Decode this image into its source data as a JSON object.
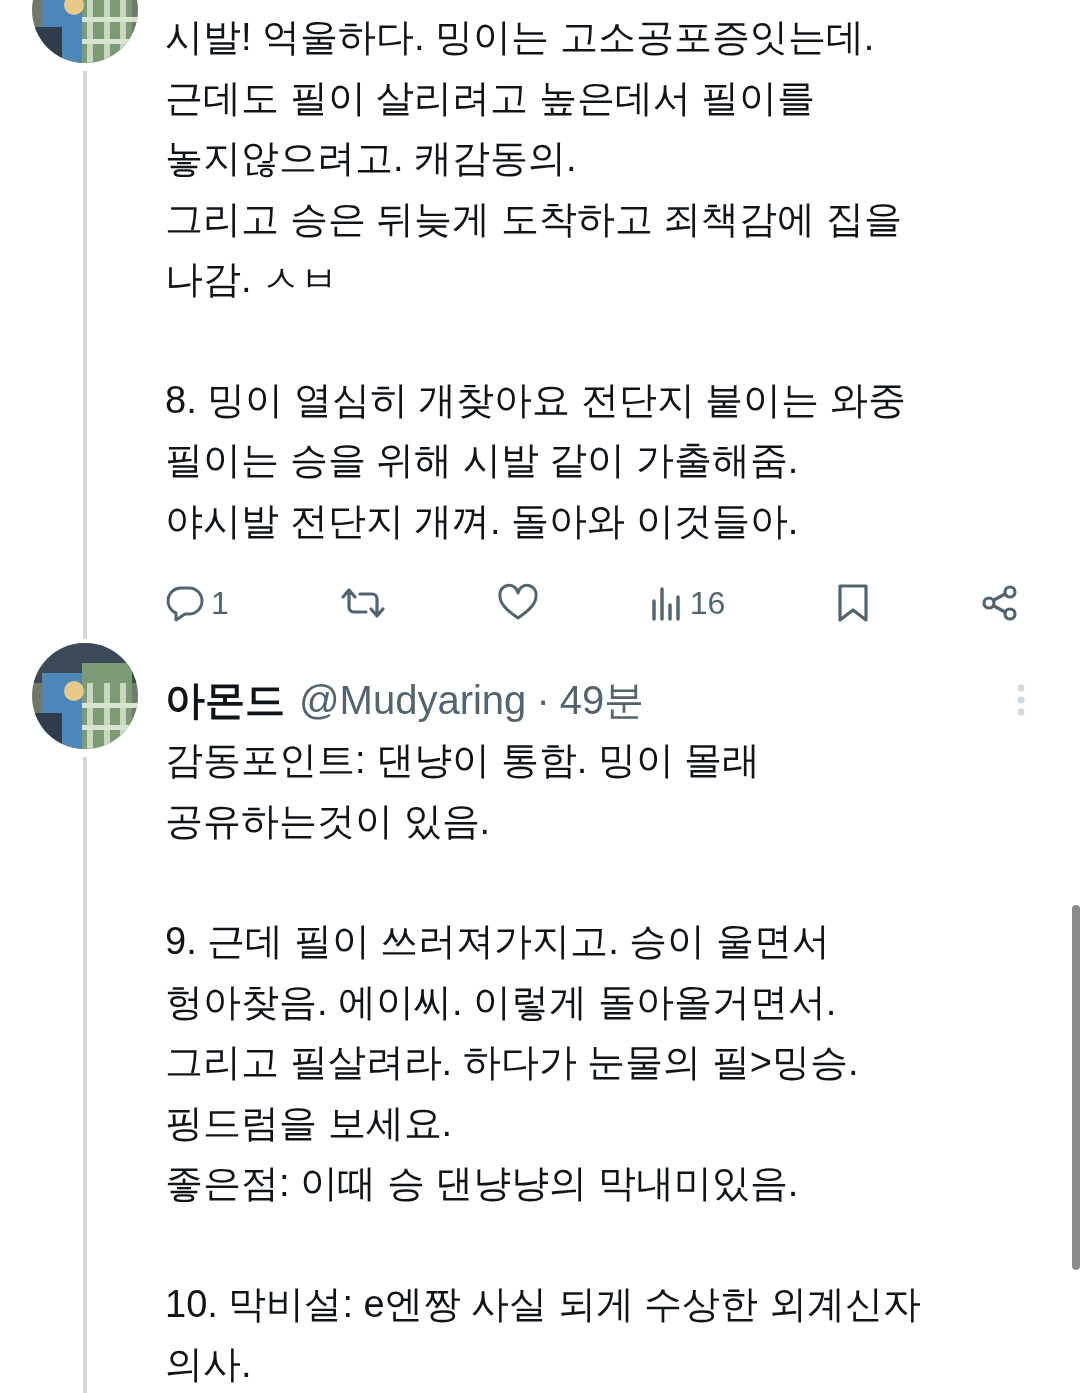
{
  "tweets": [
    {
      "avatar": {
        "kind": "picture"
      },
      "paragraphs": [
        "시발! 억울하다. 밍이는 고소공포증잇는데.\n근데도 필이 살리려고 높은데서 필이를\n놓지않으려고. 캐감동의.\n그리고 승은 뒤늦게 도착하고 죄책감에 집을\n나감. ㅅㅂ",
        "8. 밍이 열심히 개찾아요 전단지 붙이는 와중\n필이는 승을 위해 시발 같이 가출해줌.\n야시발 전단지 개껴. 돌아와 이것들아."
      ],
      "actions": [
        {
          "kind": "reply",
          "count": "1"
        },
        {
          "kind": "repost"
        },
        {
          "kind": "like"
        },
        {
          "kind": "views",
          "count": "16"
        },
        {
          "kind": "bookmark"
        },
        {
          "kind": "share"
        }
      ]
    },
    {
      "avatar": {
        "kind": "picture"
      },
      "author": {
        "name": "아몬드",
        "handle": "@Mudyaring",
        "separator": "·",
        "time": "49분"
      },
      "paragraphs": [
        "감동포인트: 댄냥이 통함. 밍이 몰래\n공유하는것이 있음.",
        "9. 근데 필이 쓰러져가지고. 승이 울면서\n헝아찾음. 에이씨. 이렇게 돌아올거면서.\n그리고 필살려라. 하다가 눈물의 필>밍승.\n핑드럼을 보세요.\n좋은점: 이때 승 댄냥냥의 막내미있음.",
        "10. 막비설: e엔짱 사실 되게 수상한 외계신자\n의사."
      ]
    }
  ]
}
